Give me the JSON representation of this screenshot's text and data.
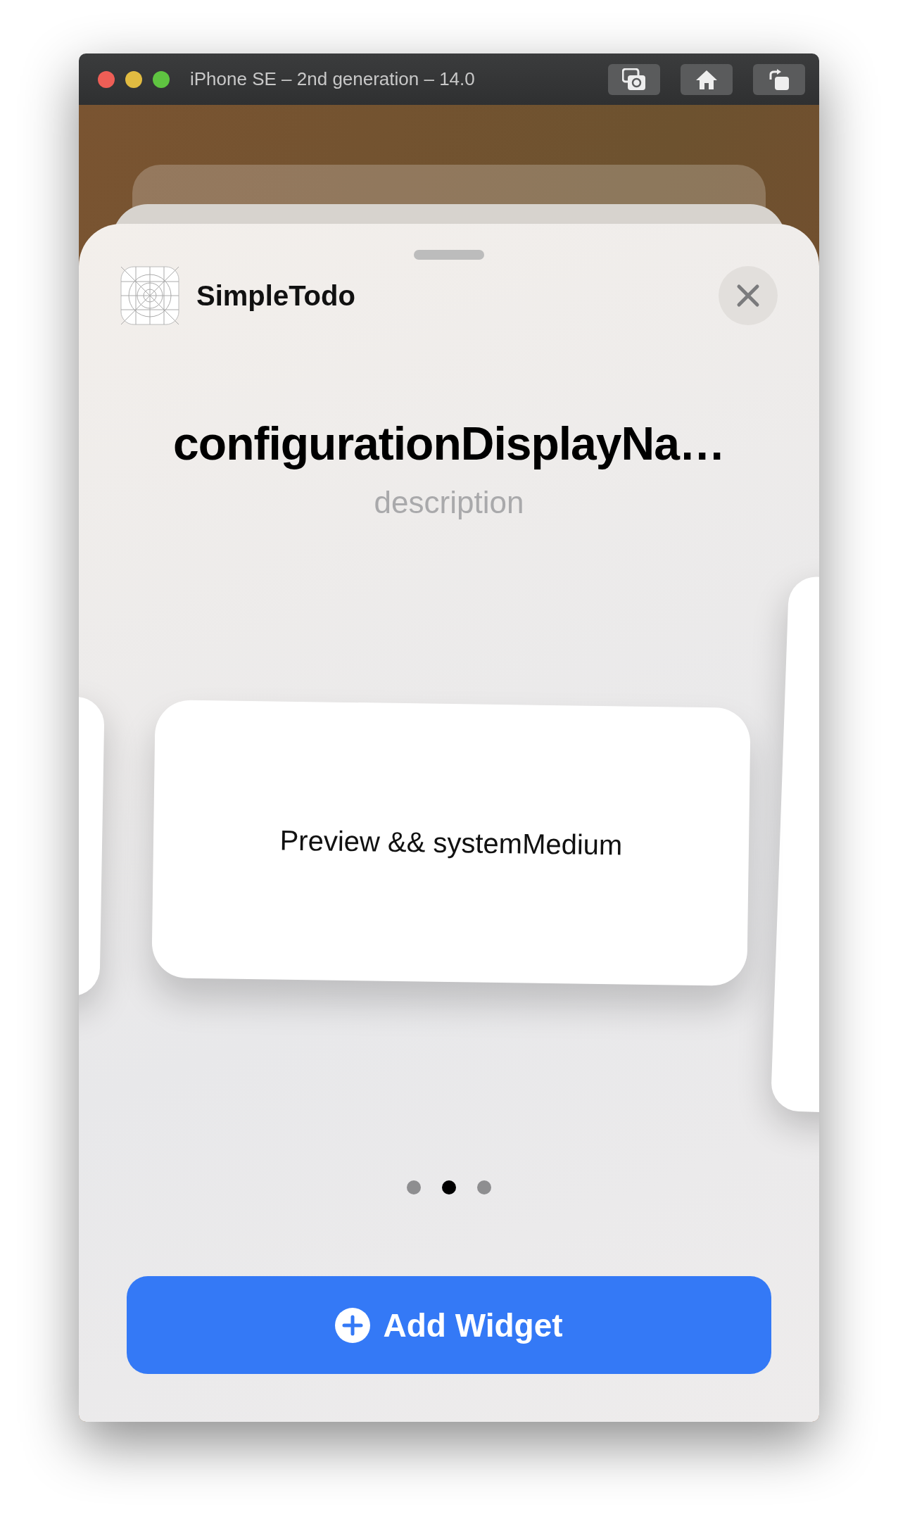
{
  "window": {
    "title": "iPhone SE – 2nd generation – 14.0",
    "toolbar_buttons": [
      {
        "kind": "screenshot"
      },
      {
        "kind": "home"
      },
      {
        "kind": "rotate"
      }
    ]
  },
  "sheet": {
    "app_name": "SimpleTodo",
    "title": "configurationDisplayNa…",
    "description": "description",
    "preview": {
      "text": "Preview && systemMedium"
    },
    "page_dots": [
      {
        "selected": false
      },
      {
        "selected": true
      },
      {
        "selected": false
      }
    ],
    "add_button": {
      "label": "Add Widget"
    }
  }
}
